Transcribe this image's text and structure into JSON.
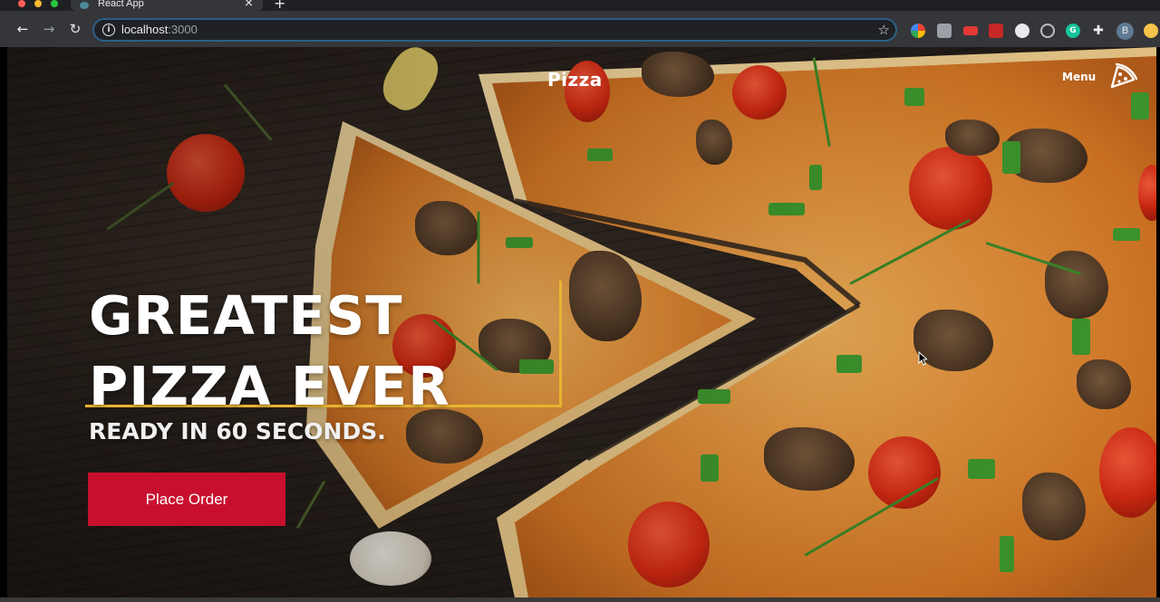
{
  "browser": {
    "tab_title": "React App",
    "tab_close": "×",
    "new_tab": "+",
    "nav": {
      "back": "←",
      "forward": "→",
      "reload": "↻"
    },
    "url_host": "localhost",
    "url_port": ":3000",
    "profile_initial": "B",
    "extensions": [
      "color-picker-extension-icon",
      "translate-extension-icon",
      "youtube-extension-icon",
      "puzzle-red-extension-icon",
      "circle-extension-icon",
      "record-extension-icon",
      "grammarly-extension-icon",
      "extensions-icon"
    ]
  },
  "navbar": {
    "logo": "Pizza",
    "menu_label": "Menu"
  },
  "hero": {
    "title_line1": "GREATEST",
    "title_line2": "PIZZA EVER",
    "subtitle": "READY IN 60 SECONDS.",
    "cta_label": "Place Order"
  },
  "colors": {
    "accent_frame": "#e8b431",
    "cta_background": "#c8102e",
    "text": "#ffffff"
  }
}
